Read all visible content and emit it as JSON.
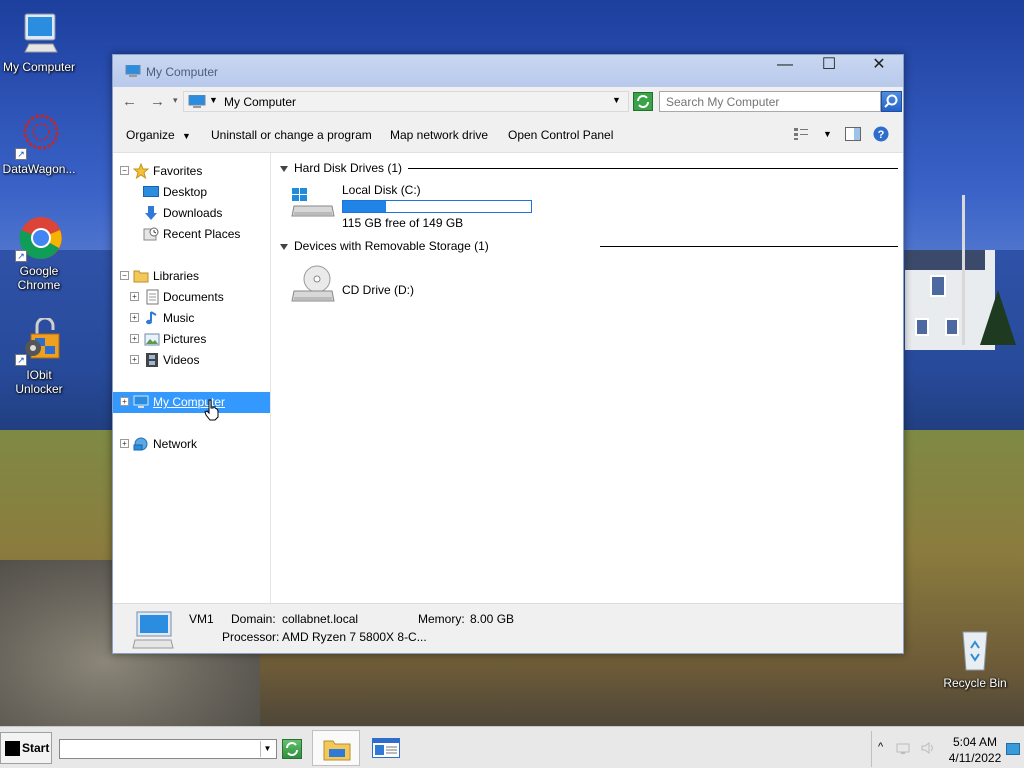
{
  "desktop": {
    "icons": [
      {
        "label": "My Computer",
        "icon": "monitor-icon"
      },
      {
        "label": "DataWagon...",
        "icon": "datawagon-icon"
      },
      {
        "label": "Google Chrome",
        "icon": "chrome-icon"
      },
      {
        "label": "IObit Unlocker",
        "icon": "iobit-unlocker-icon"
      },
      {
        "label": "Recycle Bin",
        "icon": "recycle-bin-icon"
      }
    ]
  },
  "window": {
    "title": "My Computer",
    "controls": {
      "minimize": "—",
      "maximize": "☐",
      "close": "✕"
    },
    "address": {
      "location": "My Computer"
    },
    "search": {
      "placeholder": "Search My Computer"
    },
    "toolbar": {
      "organize": "Organize",
      "uninstall": "Uninstall or change a program",
      "map_drive": "Map network drive",
      "control_panel": "Open Control Panel"
    },
    "navpane": {
      "favorites": {
        "label": "Favorites",
        "items": [
          "Desktop",
          "Downloads",
          "Recent Places"
        ]
      },
      "libraries": {
        "label": "Libraries",
        "items": [
          "Documents",
          "Music",
          "Pictures",
          "Videos"
        ]
      },
      "computer": "My Computer",
      "network": "Network"
    },
    "content": {
      "groups": [
        {
          "title": "Hard Disk Drives (1)",
          "drives": [
            {
              "name": "Local Disk (C:)",
              "free_text": "115 GB free of 149 GB",
              "used_fraction": 0.23
            }
          ]
        },
        {
          "title": "Devices with Removable Storage (1)",
          "drives": [
            {
              "name": "CD Drive (D:)"
            }
          ]
        }
      ]
    },
    "details": {
      "name": "VM1",
      "domain_label": "Domain:",
      "domain_value": "collabnet.local",
      "memory_label": "Memory:",
      "memory_value": "8.00 GB",
      "processor_label": "Processor:",
      "processor_value": "AMD Ryzen 7 5800X 8-C..."
    }
  },
  "taskbar": {
    "start_label": "Start",
    "run_value": "",
    "clock": {
      "time": "5:04 AM",
      "date": "4/11/2022"
    },
    "tray_expand": "^"
  },
  "colors": {
    "selection": "#3399ff",
    "progress": "#2083e6",
    "titlebar": "#c9d7f0"
  }
}
